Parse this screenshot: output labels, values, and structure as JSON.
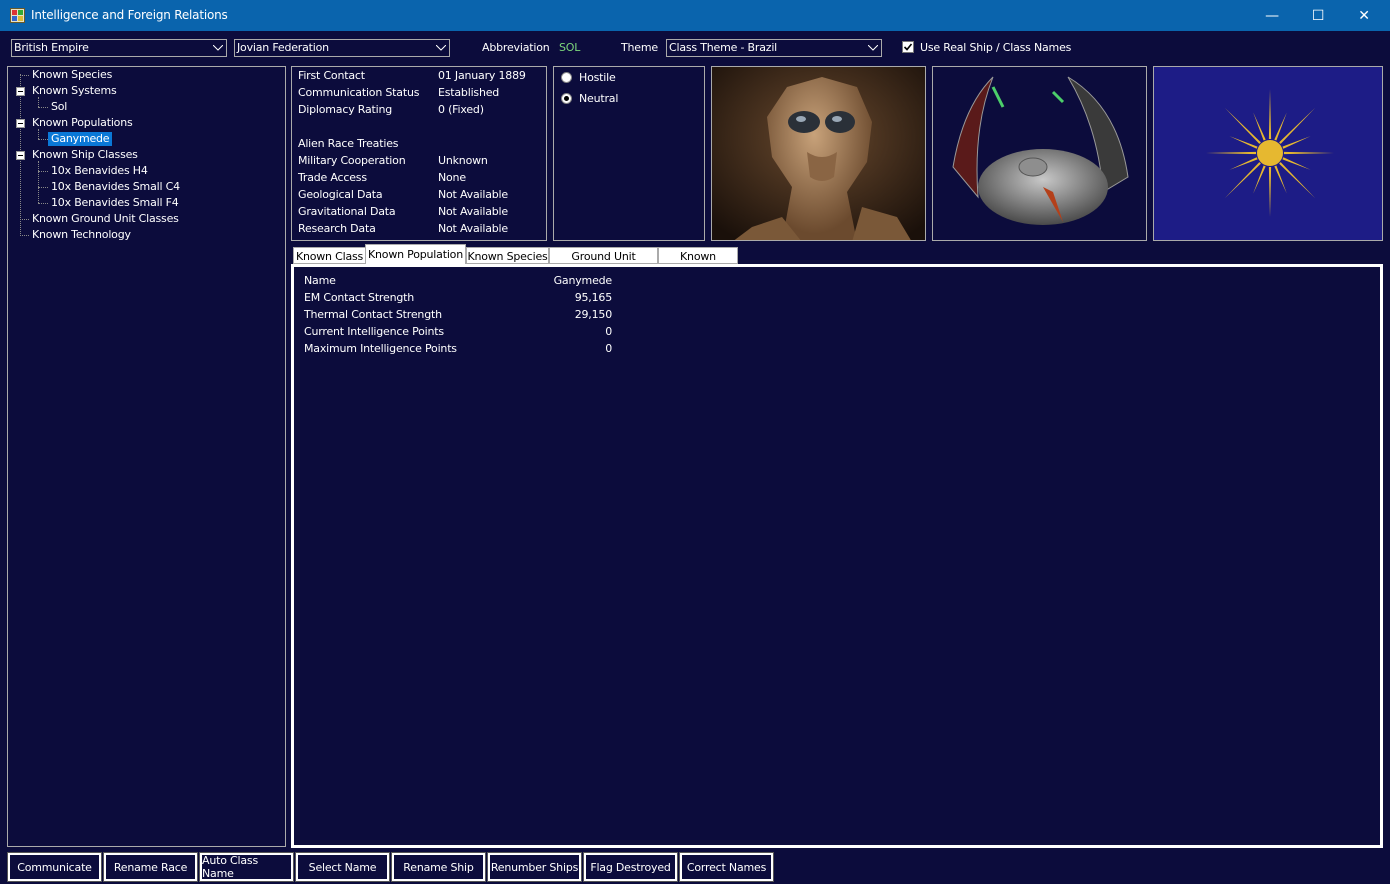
{
  "window": {
    "title": "Intelligence and Foreign Relations",
    "minimize": "—",
    "maximize": "☐",
    "close": "✕"
  },
  "toolbar": {
    "race_select": "British Empire",
    "alien_select": "Jovian Federation",
    "abbreviation_label": "Abbreviation",
    "abbreviation_value": "SOL",
    "abbreviation_color": "#7cd67c",
    "theme_label": "Theme",
    "theme_select": "Class Theme - Brazil",
    "real_names_label": "Use Real Ship / Class Names",
    "real_names_checked": true
  },
  "tree": {
    "items": [
      {
        "label": "Known Species"
      },
      {
        "label": "Known Systems"
      },
      {
        "label": "Sol"
      },
      {
        "label": "Known Populations"
      },
      {
        "label": "Ganymede",
        "selected": true
      },
      {
        "label": "Known Ship Classes"
      },
      {
        "label": "10x Benavides H4"
      },
      {
        "label": "10x Benavides Small C4"
      },
      {
        "label": "10x Benavides Small F4"
      },
      {
        "label": "Known Ground Unit Classes"
      },
      {
        "label": "Known Technology"
      }
    ]
  },
  "info": {
    "rows": [
      {
        "label": "First Contact",
        "value": "01 January 1889"
      },
      {
        "label": "Communication Status",
        "value": "Established"
      },
      {
        "label": "Diplomacy Rating",
        "value": "0  (Fixed)"
      },
      {
        "label": "Alien Race Treaties",
        "value": ""
      },
      {
        "label": "Military Cooperation",
        "value": "Unknown"
      },
      {
        "label": "Trade Access",
        "value": "None"
      },
      {
        "label": "Geological Data",
        "value": "Not Available"
      },
      {
        "label": "Gravitational Data",
        "value": "Not Available"
      },
      {
        "label": "Research Data",
        "value": "Not Available"
      }
    ]
  },
  "stance": {
    "hostile": "Hostile",
    "neutral": "Neutral",
    "selected": "neutral"
  },
  "images": {
    "species": "alien-species-portrait",
    "ship": "alien-ship-image",
    "flag": "sun-flag-icon",
    "flag_color": "#e6b830",
    "flag_bg": "#1d1c86"
  },
  "tabs": [
    {
      "label": "Known Class"
    },
    {
      "label": "Known Population",
      "active": true
    },
    {
      "label": "Known Species"
    },
    {
      "label": "Ground Unit Classes"
    },
    {
      "label": "Known System"
    }
  ],
  "population": {
    "rows": [
      {
        "label": "Name",
        "value": "Ganymede"
      },
      {
        "label": "EM Contact Strength",
        "value": "95,165"
      },
      {
        "label": "Thermal Contact Strength",
        "value": "29,150"
      },
      {
        "label": "Current Intelligence Points",
        "value": "0"
      },
      {
        "label": "Maximum Intelligence Points",
        "value": "0"
      }
    ]
  },
  "buttons": {
    "communicate": "Communicate",
    "rename_race": "Rename Race",
    "auto_class_name": "Auto Class Name",
    "select_name": "Select Name",
    "rename_ship": "Rename Ship",
    "renumber_ships": "Renumber Ships",
    "flag_destroyed": "Flag Destroyed",
    "correct_names": "Correct Names"
  }
}
